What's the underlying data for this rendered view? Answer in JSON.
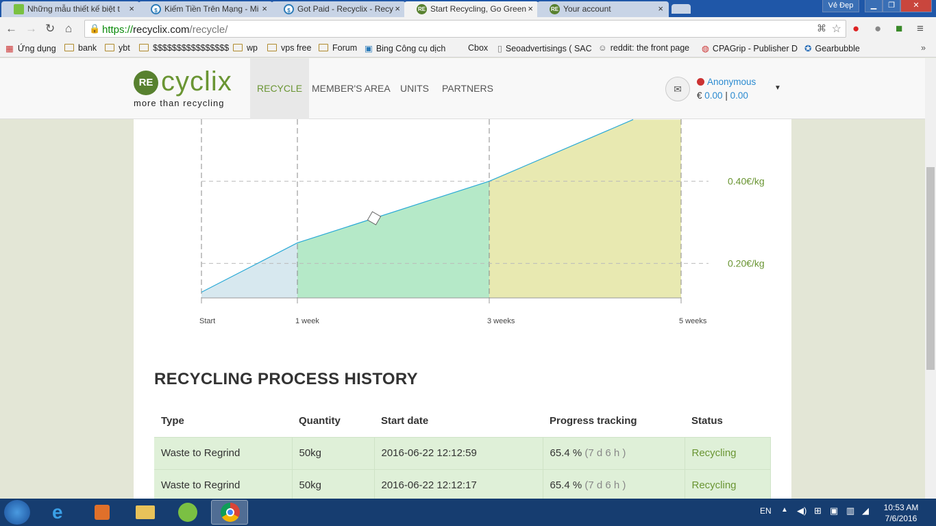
{
  "browser": {
    "tabs": [
      {
        "label": "Những mẫu thiết kế biệt t",
        "active": false
      },
      {
        "label": "Kiếm Tiền Trên Mạng - Mi",
        "active": false
      },
      {
        "label": "Got Paid - Recyclix - Recy",
        "active": false
      },
      {
        "label": "Start Recycling, Go Green",
        "active": true
      },
      {
        "label": "Your account",
        "active": false
      }
    ],
    "window_label": "Vẻ Đẹp",
    "url_scheme": "https://",
    "url_host": "recyclix.com",
    "url_path": "/recycle/"
  },
  "bookmarks": [
    {
      "label": "Ứng dụng",
      "icon": "apps-icon"
    },
    {
      "label": "bank",
      "icon": "folder-icon"
    },
    {
      "label": "ybt",
      "icon": "folder-icon"
    },
    {
      "label": "$$$$$$$$$$$$$$$$",
      "icon": "folder-icon"
    },
    {
      "label": "wp",
      "icon": "folder-icon"
    },
    {
      "label": "vps free",
      "icon": "folder-icon"
    },
    {
      "label": "Forum",
      "icon": "folder-icon"
    },
    {
      "label": "Bing Công cụ dịch",
      "icon": "translate-icon"
    },
    {
      "label": "Cbox",
      "icon": "page-icon"
    },
    {
      "label": "Seoadvertisings ( SAC",
      "icon": "page-icon"
    },
    {
      "label": "reddit: the front page",
      "icon": "reddit-icon"
    },
    {
      "label": "CPAGrip - Publisher D",
      "icon": "cpagrip-icon"
    },
    {
      "label": "Gearbubble",
      "icon": "gear-icon"
    }
  ],
  "site": {
    "logo_mark": "RE",
    "logo_word": "cyclix",
    "logo_tagline": "more than recycling",
    "nav": [
      {
        "label": "RECYCLE",
        "active": true
      },
      {
        "label": "MEMBER'S AREA",
        "active": false
      },
      {
        "label": "UNITS",
        "active": false
      },
      {
        "label": "PARTNERS",
        "active": false
      }
    ],
    "user_name": "Anonymous",
    "balance_currency": "€",
    "balance_1": "0.00",
    "balance_sep": "|",
    "balance_2": "0.00"
  },
  "chart_data": {
    "type": "area",
    "x_categories": [
      "Start",
      "1 week",
      "3 weeks",
      "5 weeks"
    ],
    "x_weeks": [
      0,
      1,
      3,
      5
    ],
    "series": [
      {
        "x": [
          0,
          1,
          3,
          4.5
        ],
        "y": [
          0.13,
          0.25,
          0.4,
          0.55
        ]
      }
    ],
    "y_tick_labels": [
      "0.20€/kg",
      "0.40€/kg"
    ],
    "y_ticks": [
      0.2,
      0.4
    ],
    "marker_week": 1.8,
    "band_colors": [
      "#d7e8ef",
      "#b5e9c8",
      "#e8e9b1"
    ],
    "line_color": "#29a9d6"
  },
  "history": {
    "title": "RECYCLING PROCESS HISTORY",
    "columns": [
      "Type",
      "Quantity",
      "Start date",
      "Progress tracking",
      "Status"
    ],
    "rows": [
      {
        "type": "Waste to Regrind",
        "quantity": "50kg",
        "start": "2016-06-22 12:12:59",
        "progress": "65.4 %",
        "remaining": "(7 d 6 h )",
        "status": "Recycling"
      },
      {
        "type": "Waste to Regrind",
        "quantity": "50kg",
        "start": "2016-06-22 12:12:17",
        "progress": "65.4 %",
        "remaining": "(7 d 6 h )",
        "status": "Recycling"
      }
    ]
  },
  "taskbar": {
    "language": "EN",
    "time": "10:53 AM",
    "date": "7/6/2016"
  }
}
